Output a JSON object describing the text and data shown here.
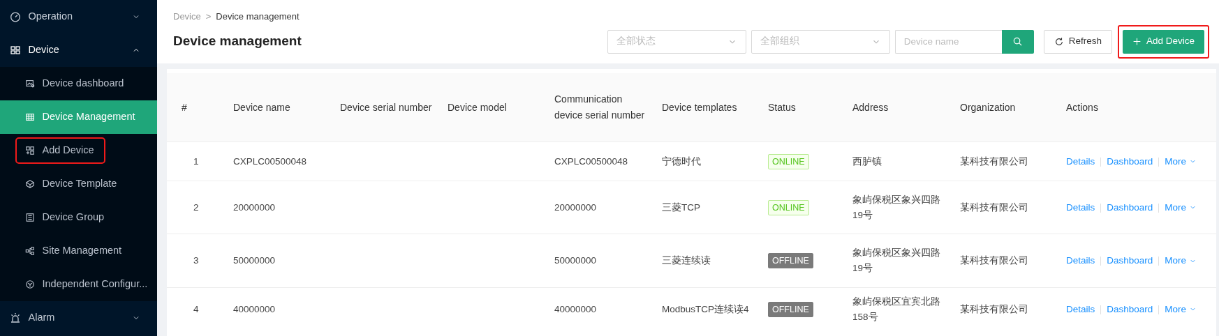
{
  "sidebar": {
    "items": [
      {
        "label": "Operation",
        "expanded": false
      },
      {
        "label": "Device",
        "expanded": true,
        "children": [
          {
            "label": "Device dashboard",
            "selected": false,
            "highlighted": false
          },
          {
            "label": "Device Management",
            "selected": true,
            "highlighted": false
          },
          {
            "label": "Add Device",
            "selected": false,
            "highlighted": true
          },
          {
            "label": "Device Template",
            "selected": false,
            "highlighted": false
          },
          {
            "label": "Device Group",
            "selected": false,
            "highlighted": false
          },
          {
            "label": "Site Management",
            "selected": false,
            "highlighted": false
          },
          {
            "label": "Independent Configur...",
            "selected": false,
            "highlighted": false
          }
        ]
      },
      {
        "label": "Alarm",
        "expanded": false
      }
    ]
  },
  "breadcrumb": {
    "items": [
      "Device",
      "Device management"
    ],
    "separator": ">"
  },
  "page_title": "Device management",
  "filters": {
    "status": {
      "placeholder": "全部状态"
    },
    "organization": {
      "placeholder": "全部组织"
    },
    "search": {
      "placeholder": "Device name"
    }
  },
  "buttons": {
    "refresh": "Refresh",
    "add": {
      "label": "Add Device",
      "highlighted": true
    }
  },
  "table": {
    "columns": [
      "#",
      "Device name",
      "Device serial number",
      "Device model",
      "Communication device serial number",
      "Device templates",
      "Status",
      "Address",
      "Organization",
      "Actions"
    ],
    "rows": [
      {
        "index": "1",
        "name": "CXPLC00500048",
        "serial": "",
        "model": "",
        "comm_serial": "CXPLC00500048",
        "template": "宁德时代",
        "status": {
          "label": "ONLINE",
          "kind": "online"
        },
        "address": "西胪镇",
        "organization": "某科技有限公司",
        "actions": [
          "Details",
          "Dashboard",
          "More"
        ]
      },
      {
        "index": "2",
        "name": "20000000",
        "serial": "",
        "model": "",
        "comm_serial": "20000000",
        "template": "三菱TCP",
        "status": {
          "label": "ONLINE",
          "kind": "online"
        },
        "address": "象屿保税区象兴四路19号",
        "organization": "某科技有限公司",
        "actions": [
          "Details",
          "Dashboard",
          "More"
        ]
      },
      {
        "index": "3",
        "name": "50000000",
        "serial": "",
        "model": "",
        "comm_serial": "50000000",
        "template": "三菱连续读",
        "status": {
          "label": "OFFLINE",
          "kind": "offline"
        },
        "address": "象屿保税区象兴四路19号",
        "organization": "某科技有限公司",
        "actions": [
          "Details",
          "Dashboard",
          "More"
        ]
      },
      {
        "index": "4",
        "name": "40000000",
        "serial": "",
        "model": "",
        "comm_serial": "40000000",
        "template": "ModbusTCP连续读4",
        "status": {
          "label": "OFFLINE",
          "kind": "offline"
        },
        "address": "象屿保税区宜宾北路158号",
        "organization": "某科技有限公司",
        "actions": [
          "Details",
          "Dashboard",
          "More"
        ]
      }
    ]
  }
}
